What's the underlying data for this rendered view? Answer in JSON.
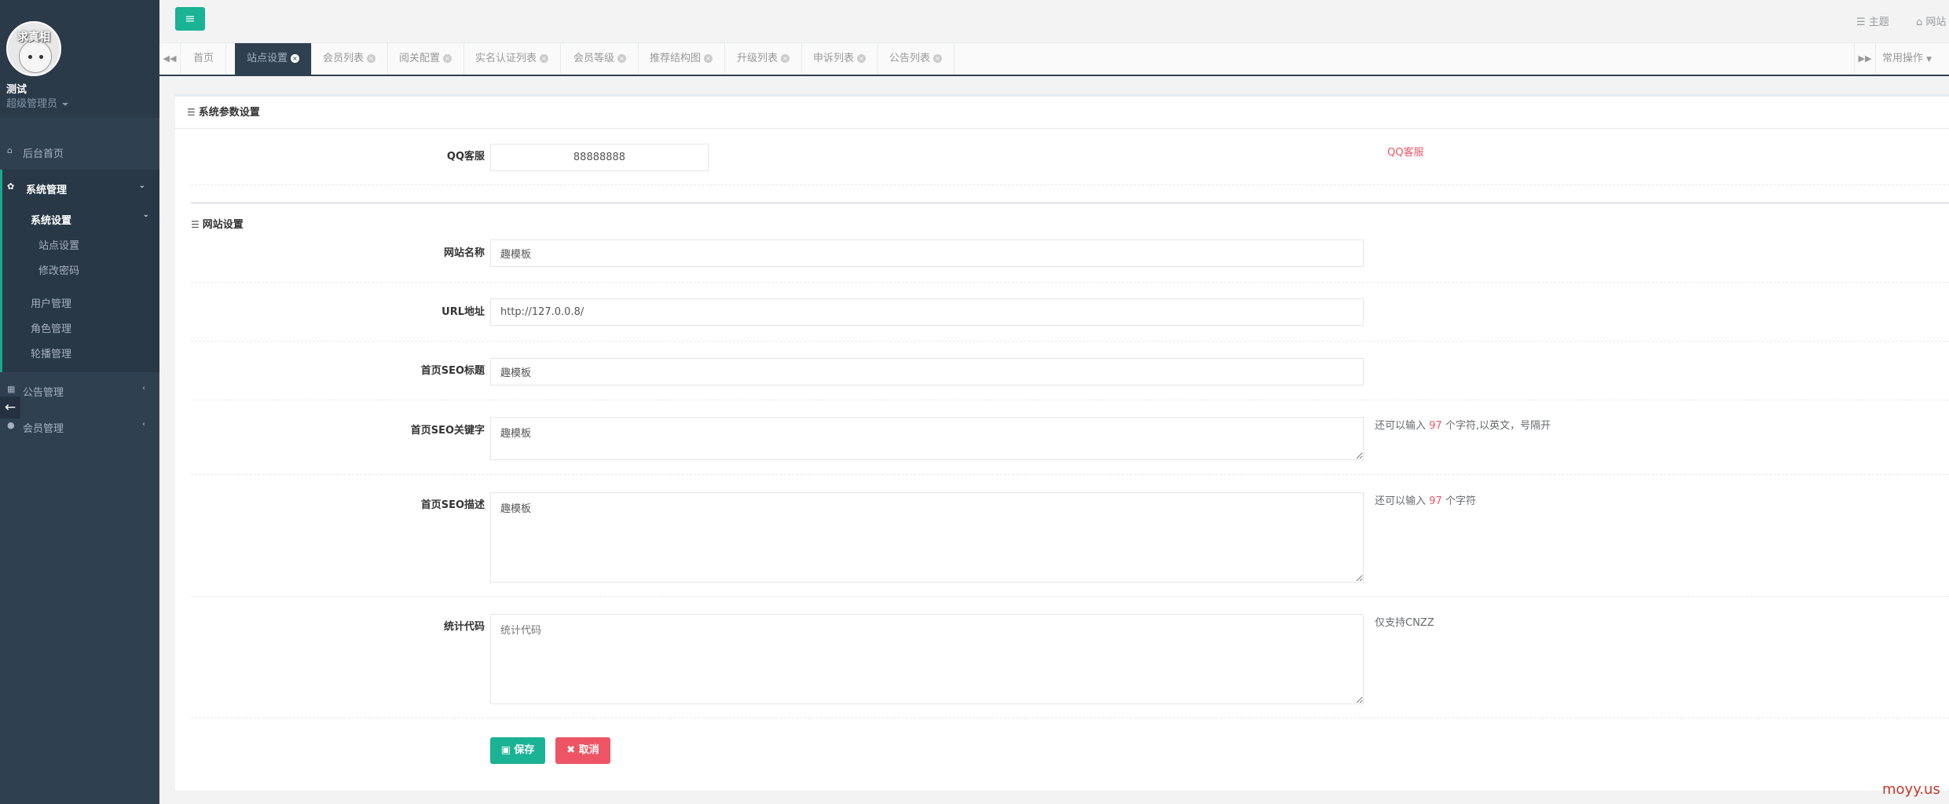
{
  "sidebar": {
    "avatar_text": "求真相",
    "user_name": "测试",
    "user_role": "超级管理员",
    "items": {
      "home": "后台首页",
      "system": "系统管理",
      "system_settings": "系统设置",
      "site_settings": "站点设置",
      "change_password": "修改密码",
      "user_mgmt": "用户管理",
      "role_mgmt": "角色管理",
      "carousel_mgmt": "轮播管理",
      "notice_mgmt": "公告管理",
      "member_mgmt": "会员管理"
    }
  },
  "topbar": {
    "menu_icon": "≡",
    "theme": "主题",
    "site": "网站"
  },
  "tabs": {
    "items": [
      "首页",
      "站点设置",
      "会员列表",
      "阅关配置",
      "实名认证列表",
      "会员等级",
      "推荐结构图",
      "升级列表",
      "申诉列表",
      "公告列表"
    ],
    "ops": "常用操作"
  },
  "panel": {
    "title": "系统参数设置",
    "qq_label": "QQ客服",
    "qq_value": "88888888",
    "qq_hint": "QQ客服",
    "site_section": "网站设置",
    "site_name_label": "网站名称",
    "site_name_value": "趣模板",
    "url_label": "URL地址",
    "url_value": "http://127.0.0.8/",
    "seo_title_label": "首页SEO标题",
    "seo_title_value": "趣模板",
    "seo_kw_label": "首页SEO关键字",
    "seo_kw_value": "趣模板",
    "seo_kw_hint_pre": "还可以输入",
    "seo_kw_hint_num": "97",
    "seo_kw_hint_post": "个字符,以英文，号隔开",
    "seo_desc_label": "首页SEO描述",
    "seo_desc_value": "趣模板",
    "seo_desc_hint_pre": "还可以输入",
    "seo_desc_hint_num": "97",
    "seo_desc_hint_post": "个字符",
    "stats_label": "统计代码",
    "stats_placeholder": "统计代码",
    "stats_hint": "仅支持CNZZ",
    "save": "保存",
    "cancel": "取消"
  },
  "watermark": "moyy.us"
}
